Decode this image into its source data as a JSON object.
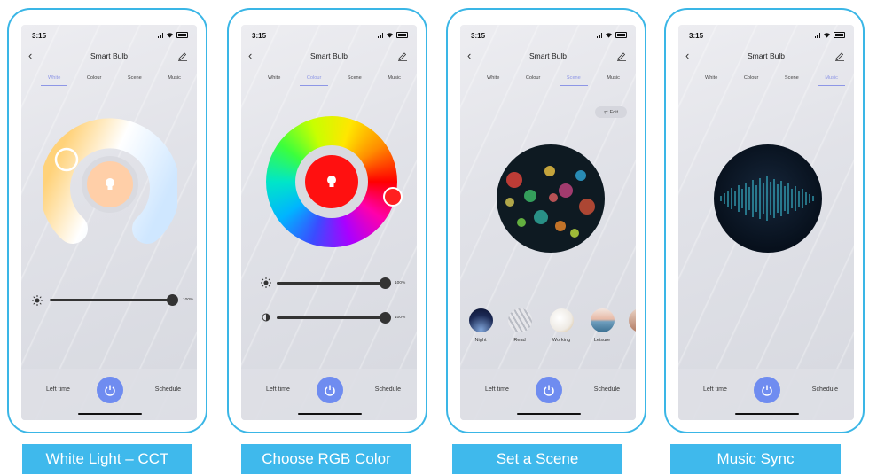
{
  "status_time": "3:15",
  "app_title": "Smart Bulb",
  "tabs": [
    "White",
    "Colour",
    "Scene",
    "Music"
  ],
  "bottom": {
    "left_time": "Left time",
    "schedule": "Schedule"
  },
  "panels": [
    {
      "caption": "White Light – CCT",
      "active_tab": "White",
      "brightness": {
        "value": 1.0,
        "label": "100%"
      }
    },
    {
      "caption": "Choose RGB Color",
      "active_tab": "Colour",
      "brightness": {
        "value": 1.0,
        "label": "100%"
      },
      "saturation": {
        "value": 1.0,
        "label": "100%"
      },
      "selected_color": "#ff0000"
    },
    {
      "caption": "Set a Scene",
      "active_tab": "Scene",
      "edit_label": "Edit",
      "scenes": [
        {
          "label": "Night"
        },
        {
          "label": "Read"
        },
        {
          "label": "Working"
        },
        {
          "label": "Leisure"
        },
        {
          "label": "Sc"
        }
      ]
    },
    {
      "caption": "Music Sync",
      "active_tab": "Music"
    }
  ],
  "colors": {
    "accent": "#8d96e6",
    "power": "#6f8cf0",
    "border": "#3ab6e6",
    "caption_bg": "#3fb9ec"
  }
}
